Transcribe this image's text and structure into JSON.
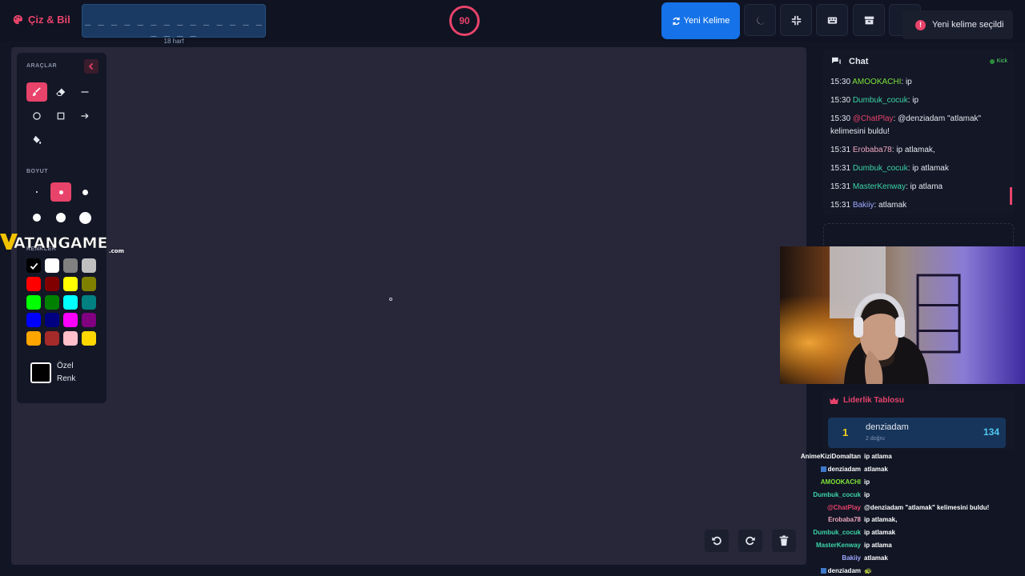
{
  "app": {
    "title": "Çiz & Bil",
    "word_mask": "_ _ _ _ _ _ _ _ _ _ _ _ _ _ _ _ _ _",
    "word_hint": "18 harf",
    "timer": "90",
    "new_word_label": "Yeni Kelime",
    "accent": "#e8436a",
    "primary": "#1572e8"
  },
  "toast": {
    "text": "Yeni kelime seçildi",
    "icon": "info-icon"
  },
  "tools": {
    "section_tools": "ARAÇLAR",
    "section_size": "BOYUT",
    "section_colors": "RENKLER",
    "items": [
      {
        "icon": "brush-icon",
        "active": true
      },
      {
        "icon": "eraser-icon",
        "active": false
      },
      {
        "icon": "line-icon",
        "active": false
      },
      {
        "icon": "circle-icon",
        "active": false
      },
      {
        "icon": "square-icon",
        "active": false
      },
      {
        "icon": "arrow-icon",
        "active": false
      },
      {
        "icon": "fill-bucket-icon",
        "active": false
      }
    ],
    "sizes": [
      "xs",
      "s",
      "m",
      "l",
      "xl",
      "xxl"
    ],
    "active_size": "s",
    "colors": [
      "#000000",
      "#ffffff",
      "#808080",
      "#c0c0c0",
      "#ff0000",
      "#800000",
      "#ffff00",
      "#808000",
      "#00ff00",
      "#008000",
      "#00ffff",
      "#008080",
      "#0000ff",
      "#000080",
      "#ff00ff",
      "#800080",
      "#ffa500",
      "#a52a2a",
      "#ffc0cb",
      "#ffd700"
    ],
    "selected_color": "#000000",
    "custom_color_label": "Özel Renk"
  },
  "watermark": {
    "brand": "VATANGAME",
    "sub": ".com"
  },
  "chat": {
    "title": "Chat",
    "platform": "Kick",
    "messages": [
      {
        "time": "15:30",
        "user": "AMOOKACHI",
        "color": "#7ee33a",
        "text": ": ip"
      },
      {
        "time": "15:30",
        "user": "Dumbuk_cocuk",
        "color": "#3dd6a8",
        "text": ": ip"
      },
      {
        "time": "15:30",
        "user": "@ChatPlay",
        "color": "#e8436a",
        "text": ": @denziadam \"atlamak\" kelimesini buldu!"
      },
      {
        "time": "15:31",
        "user": "Erobaba78",
        "color": "#f0a8c0",
        "text": ": ip atlamak,"
      },
      {
        "time": "15:31",
        "user": "Dumbuk_cocuk",
        "color": "#3dd6a8",
        "text": ": ip atlamak"
      },
      {
        "time": "15:31",
        "user": "MasterKenway",
        "color": "#3dd6a8",
        "text": ": ip atlama"
      },
      {
        "time": "15:31",
        "user": "Bakiiy",
        "color": "#9fa8ff",
        "text": ": atlamak"
      }
    ]
  },
  "leaderboard": {
    "title": "Liderlik Tablosu",
    "rows": [
      {
        "rank": "1",
        "name": "denziadam",
        "sub": "2 doğru",
        "score": "134"
      }
    ]
  },
  "overlay_chat": [
    {
      "user": "AnimeKiziDomaltan",
      "color": "#ffffff",
      "text": "ip atlama"
    },
    {
      "user": "denziadam",
      "color": "#ffffff",
      "text": "atlamak",
      "badge": true
    },
    {
      "user": "AMOOKACHI",
      "color": "#7ee33a",
      "text": "ip"
    },
    {
      "user": "Dumbuk_cocuk",
      "color": "#3dd6a8",
      "text": "ip"
    },
    {
      "user": "@ChatPlay",
      "color": "#e8436a",
      "text": "@denziadam \"atlamak\" kelimesini buldu!"
    },
    {
      "user": "Erobaba78",
      "color": "#f0a8c0",
      "text": "ip atlamak,"
    },
    {
      "user": "Dumbuk_cocuk",
      "color": "#3dd6a8",
      "text": "ip atlamak"
    },
    {
      "user": "MasterKenway",
      "color": "#3dd6a8",
      "text": "ip atlama"
    },
    {
      "user": "Bakiiy",
      "color": "#9fa8ff",
      "text": "atlamak"
    },
    {
      "user": "denziadam",
      "color": "#ffffff",
      "text": "🐢",
      "badge": true
    }
  ]
}
